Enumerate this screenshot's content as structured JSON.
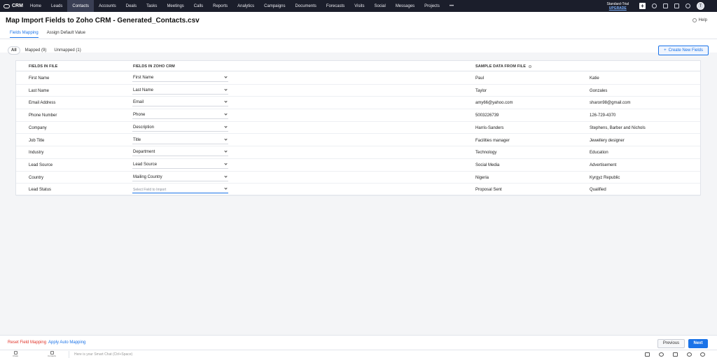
{
  "app": {
    "brand": "CRM"
  },
  "nav": {
    "items": [
      "Home",
      "Leads",
      "Contacts",
      "Accounts",
      "Deals",
      "Tasks",
      "Meetings",
      "Calls",
      "Reports",
      "Analytics",
      "Campaigns",
      "Documents",
      "Forecasts",
      "Visits",
      "Social",
      "Messages",
      "Projects",
      "•••"
    ],
    "active": "Contacts",
    "trial_label": "Standard-Trial",
    "upgrade_label": "UPGRADE",
    "avatar_initial": "T",
    "icons": [
      "plus-icon",
      "search-icon",
      "feeds-icon",
      "calendar-icon",
      "settings-icon"
    ]
  },
  "page": {
    "title": "Map Import Fields to Zoho CRM - Generated_Contacts.csv",
    "help_label": "Help",
    "tabs": [
      "Fields Mapping",
      "Assign Default Value"
    ],
    "filters": {
      "all": "All",
      "mapped": "Mapped (9)",
      "unmapped": "Unmapped (1)"
    },
    "create_button": "Create New Fields"
  },
  "table": {
    "headers": {
      "file": "FIELDS IN FILE",
      "crm": "FIELDS IN ZOHO CRM",
      "sample": "SAMPLE DATA FROM FILE"
    },
    "rows": [
      {
        "file_field": "First Name",
        "crm_field": "First Name",
        "sample1": "Paul",
        "sample2": "Katie"
      },
      {
        "file_field": "Last Name",
        "crm_field": "Last Name",
        "sample1": "Taylor",
        "sample2": "Gonzales"
      },
      {
        "file_field": "Email Address",
        "crm_field": "Email",
        "sample1": "amy66@yahoo.com",
        "sample2": "sharon98@gmail.com"
      },
      {
        "file_field": "Phone Number",
        "crm_field": "Phone",
        "sample1": "5003226739",
        "sample2": "126-729-4370"
      },
      {
        "file_field": "Company",
        "crm_field": "Description",
        "sample1": "Harris-Sanders",
        "sample2": "Stephens, Barber and Nichols"
      },
      {
        "file_field": "Job Title",
        "crm_field": "Title",
        "sample1": "Facilities manager",
        "sample2": "Jewellery designer"
      },
      {
        "file_field": "Industry",
        "crm_field": "Department",
        "sample1": "Technology",
        "sample2": "Education"
      },
      {
        "file_field": "Lead Source",
        "crm_field": "Lead Source",
        "sample1": "Social Media",
        "sample2": "Advertisement"
      },
      {
        "file_field": "Country",
        "crm_field": "Mailing Country",
        "sample1": "Nigeria",
        "sample2": "Kyrgyz Republic"
      },
      {
        "file_field": "Lead Status",
        "crm_field": "",
        "placeholder": "Select Field to Import",
        "sample1": "Proposal Sent",
        "sample2": "Qualified"
      }
    ]
  },
  "footer": {
    "reset_label": "Reset Field Mapping",
    "auto_label": "Apply Auto Mapping",
    "previous_label": "Previous",
    "next_label": "Next"
  },
  "bottombar": {
    "left_icons": [
      {
        "icon": "chats-icon",
        "label": "Chats"
      },
      {
        "icon": "contacts-icon",
        "label": "Contacts"
      }
    ],
    "chat_placeholder": "Here is your Smart Chat (Ctrl+Space)"
  },
  "colors": {
    "nav_bg": "#1b1e2b",
    "accent": "#1a73e8",
    "danger": "#e0342a"
  }
}
